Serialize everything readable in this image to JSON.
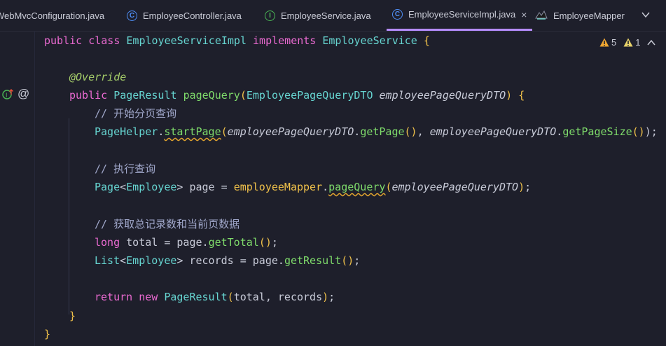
{
  "tabs": [
    {
      "label": "WebMvcConfiguration.java",
      "icon": "none"
    },
    {
      "label": "EmployeeController.java",
      "icon": "class-icon"
    },
    {
      "label": "EmployeeService.java",
      "icon": "interface-icon"
    },
    {
      "label": "EmployeeServiceImpl.java",
      "icon": "class-icon",
      "active": true,
      "close": "×"
    },
    {
      "label": "EmployeeMapper",
      "icon": "mybatis-icon"
    }
  ],
  "inspections": {
    "warning_count": "5",
    "weak_warning_count": "1"
  },
  "code": {
    "l1_public": "public",
    "l1_class": "class",
    "l1_name": "EmployeeServiceImpl",
    "l1_implements": "implements",
    "l1_iface": "EmployeeService",
    "l1_brace": "{",
    "l2_annotation": "@Override",
    "l3_public": "public",
    "l3_type": "PageResult",
    "l3_method": "pageQuery",
    "l3_open": "(",
    "l3_ptype": "EmployeePageQueryDTO",
    "l3_pname": "employeePageQueryDTO",
    "l3_close": ")",
    "l3_brace": "{",
    "c1": "// 开始分页查询",
    "l5_cls": "PageHelper",
    "l5_dot": ".",
    "l5_fn": "startPage",
    "l5_open": "(",
    "l5_arg1": "employeePageQueryDTO",
    "l5_dot2": ".",
    "l5_get1": "getPage",
    "l5_p1": "()",
    "l5_comma": ", ",
    "l5_arg2": "employeePageQueryDTO",
    "l5_dot3": ".",
    "l5_get2": "getPageSize",
    "l5_p2": "()",
    "l5_end": ");",
    "c2": "// 执行查询",
    "l7_type": "Page",
    "l7_lt": "<",
    "l7_gen": "Employee",
    "l7_rest": "> page = ",
    "l7_mapper": "employeeMapper",
    "l7_dot": ".",
    "l7_fn": "pageQuery",
    "l7_open": "(",
    "l7_arg": "employeePageQueryDTO",
    "l7_close": ")",
    "l7_end": ";",
    "c3": "// 获取总记录数和当前页数据",
    "l9_long": "long",
    "l9_rest": " total = page.",
    "l9_fn": "getTotal",
    "l9_p": "()",
    "l9_end": ";",
    "l10_type": "List",
    "l10_lt": "<",
    "l10_gen": "Employee",
    "l10_rest": "> records = page.",
    "l10_fn": "getResult",
    "l10_p": "()",
    "l10_end": ";",
    "l11_return": "return",
    "l11_new": "new",
    "l11_cls": "PageResult",
    "l11_open": "(",
    "l11_args": "total, records",
    "l11_close": ")",
    "l11_end": ";",
    "l12_brace": "}",
    "l13_brace": "}"
  },
  "gutter": {
    "override_icon": "↑",
    "at_icon": "@"
  },
  "colors": {
    "keyword": "#ea6ad1",
    "class": "#66d4d0",
    "method": "#7fdc6b",
    "paren": "#f0c14a",
    "accent": "#b68cff"
  }
}
